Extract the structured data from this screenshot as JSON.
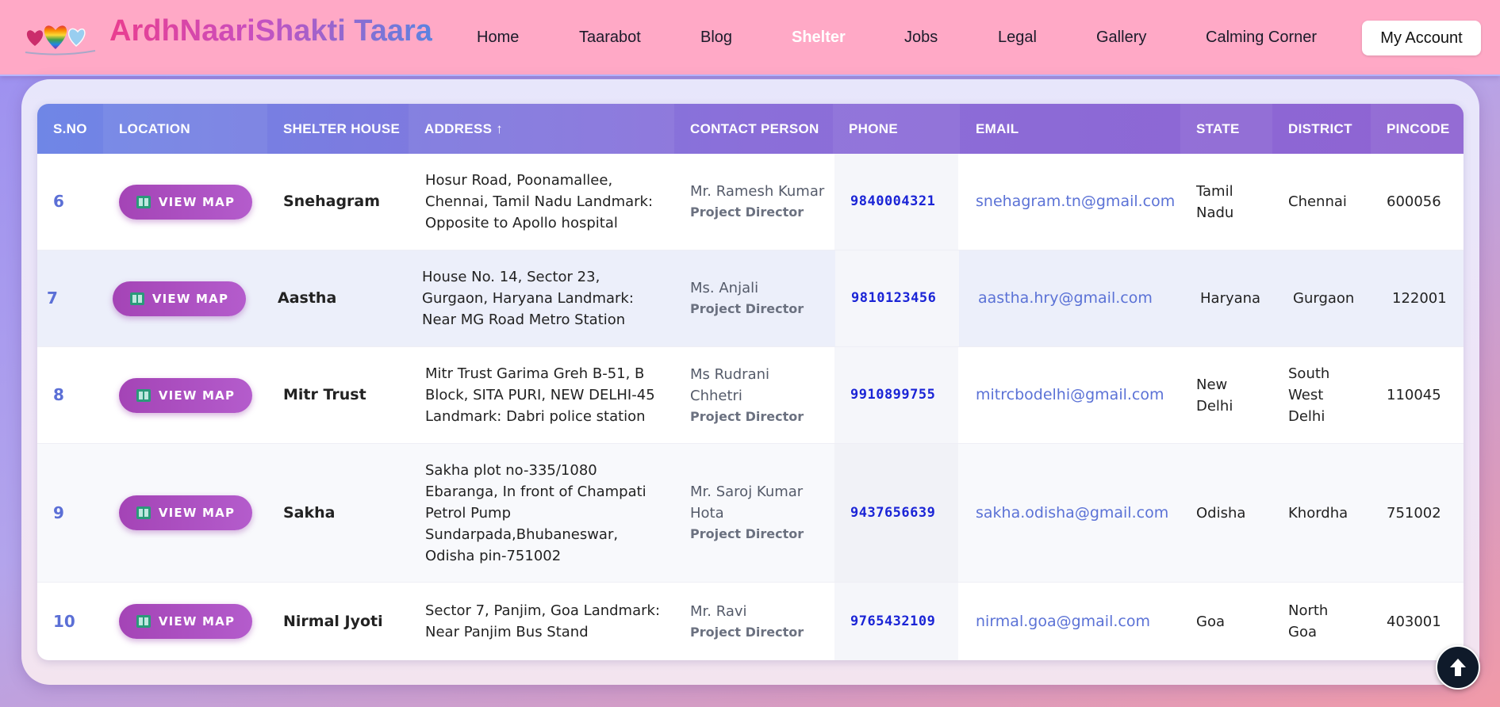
{
  "header": {
    "brand": "ArdhNaariShakti Taara",
    "nav": [
      {
        "label": "Home",
        "active": false
      },
      {
        "label": "Taarabot",
        "active": false
      },
      {
        "label": "Blog",
        "active": false
      },
      {
        "label": "Shelter",
        "active": true
      },
      {
        "label": "Jobs",
        "active": false
      },
      {
        "label": "Legal",
        "active": false
      },
      {
        "label": "Gallery",
        "active": false
      },
      {
        "label": "Calming Corner",
        "active": false
      }
    ],
    "account_label": "My Account"
  },
  "table": {
    "columns": [
      "S.NO",
      "LOCATION",
      "SHELTER HOUSE",
      "ADDRESS ↑",
      "CONTACT PERSON",
      "PHONE",
      "EMAIL",
      "STATE",
      "DISTRICT",
      "PINCODE"
    ],
    "map_button_label": "VIEW MAP",
    "rows": [
      {
        "sno": "6",
        "shelter": "Snehagram",
        "address": "Hosur Road, Poonamallee, Chennai, Tamil Nadu Landmark: Opposite to Apollo hospital",
        "contact_name": "Mr. Ramesh Kumar",
        "contact_role": "Project Director",
        "phone": "9840004321",
        "email": "snehagram.tn@gmail.com",
        "state": "Tamil Nadu",
        "district": "Chennai",
        "pincode": "600056"
      },
      {
        "sno": "7",
        "shelter": "Aastha",
        "address": "House No. 14, Sector 23, Gurgaon, Haryana Landmark: Near MG Road Metro Station",
        "contact_name": "Ms. Anjali",
        "contact_role": "Project Director",
        "phone": "9810123456",
        "email": "aastha.hry@gmail.com",
        "state": "Haryana",
        "district": "Gurgaon",
        "pincode": "122001"
      },
      {
        "sno": "8",
        "shelter": "Mitr Trust",
        "address": "Mitr Trust Garima Greh B-51, B Block, SITA PURI, NEW DELHI-45 Landmark: Dabri police station",
        "contact_name": "Ms Rudrani Chhetri",
        "contact_role": "Project Director",
        "phone": "9910899755",
        "email": "mitrcbodelhi@gmail.com",
        "state": "New Delhi",
        "district": "South West Delhi",
        "pincode": "110045"
      },
      {
        "sno": "9",
        "shelter": "Sakha",
        "address": "Sakha plot no-335/1080 Ebaranga, In front of Champati Petrol Pump Sundarpada,Bhubaneswar, Odisha pin-751002",
        "contact_name": "Mr. Saroj Kumar Hota",
        "contact_role": "Project Director",
        "phone": "9437656639",
        "email": "sakha.odisha@gmail.com",
        "state": "Odisha",
        "district": "Khordha",
        "pincode": "751002"
      },
      {
        "sno": "10",
        "shelter": "Nirmal Jyoti",
        "address": "Sector 7, Panjim, Goa Landmark: Near Panjim Bus Stand",
        "contact_name": "Mr. Ravi",
        "contact_role": "Project Director",
        "phone": "9765432109",
        "email": "nirmal.goa@gmail.com",
        "state": "Goa",
        "district": "North Goa",
        "pincode": "403001"
      }
    ]
  },
  "icons": {
    "logo": "rainbow-hearts-logo",
    "map": "map-book-icon",
    "scroll_top": "arrow-up-icon"
  }
}
